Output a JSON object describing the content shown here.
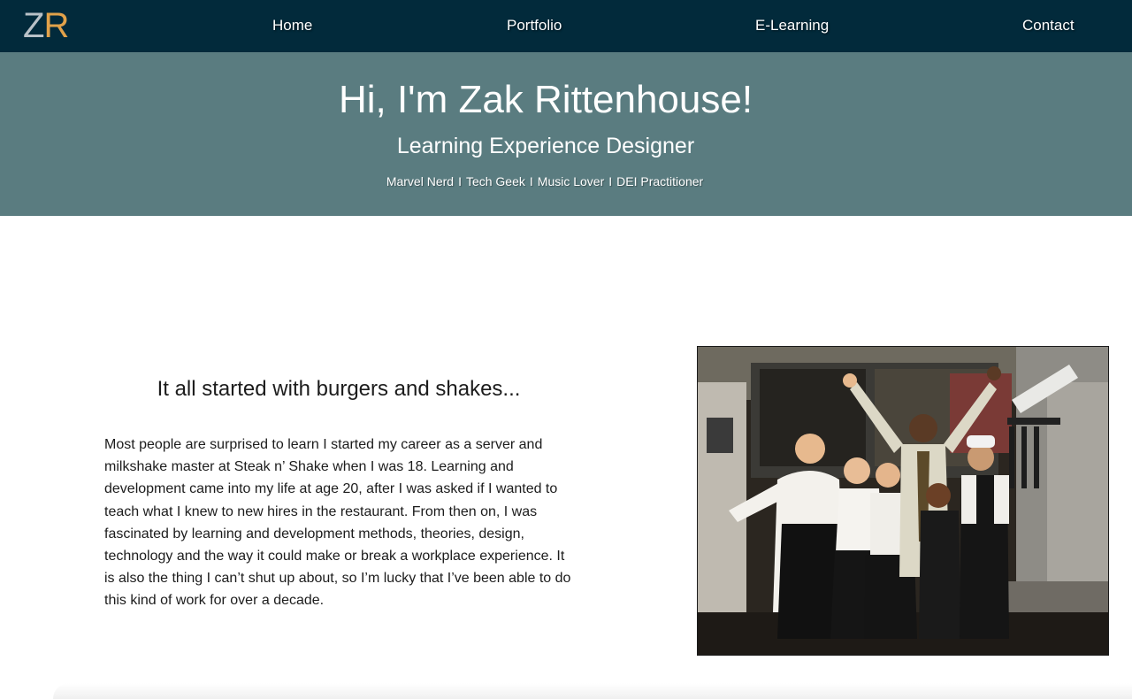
{
  "logo": {
    "letter1": "Z",
    "letter2": "R"
  },
  "nav": {
    "home": "Home",
    "portfolio": "Portfolio",
    "elearning": "E-Learning",
    "contact": "Contact"
  },
  "hero": {
    "title": "Hi, I'm Zak Rittenhouse!",
    "subtitle": "Learning Experience Designer",
    "tags": [
      "Marvel Nerd",
      "Tech Geek",
      "Music Lover",
      "DEI Practitioner"
    ],
    "separator": "I"
  },
  "story": {
    "heading": "It all started with burgers and shakes...",
    "body": "Most people are surprised to learn I started my career as a server and milkshake master at Steak n’ Shake when I was 18. Learning and development came into my life at age 20, after I was asked if I wanted to teach what I knew to new hires in the restaurant. From then on, I was fascinated by learning and development methods, theories, design, technology and the way it could make or break a workplace experience. It is also the thing I can’t shut up about, so I’m lucky that I’ve been able to do this kind of work for over a decade."
  },
  "colors": {
    "navbar": "#022a3b",
    "hero": "#5a7c80",
    "logo_z": "#b9c1c7",
    "logo_r": "#e2a24a"
  }
}
